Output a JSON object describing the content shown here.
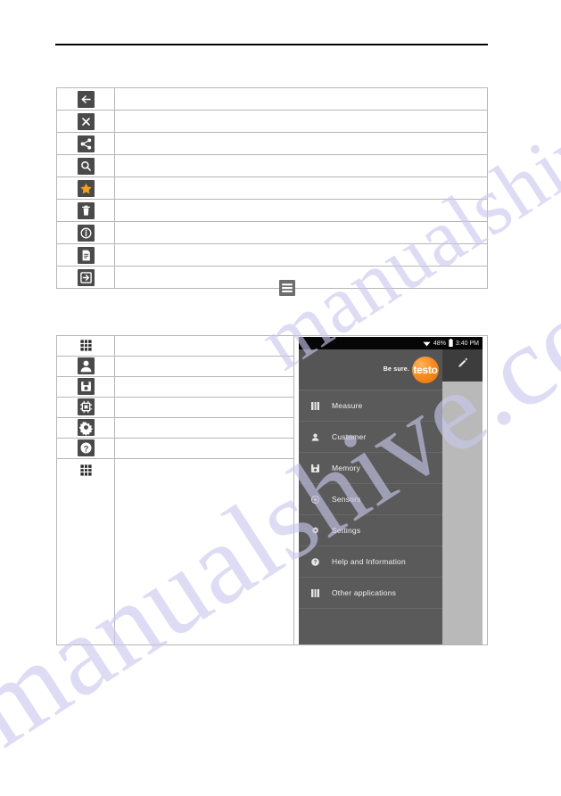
{
  "page": {
    "header_rule": true
  },
  "icon_table_1": {
    "rows": [
      {
        "icon": "back-arrow-icon",
        "description": ""
      },
      {
        "icon": "close-x-icon",
        "description": ""
      },
      {
        "icon": "share-icon",
        "description": ""
      },
      {
        "icon": "search-icon",
        "description": ""
      },
      {
        "icon": "star-favorite-icon",
        "description": ""
      },
      {
        "icon": "trash-delete-icon",
        "description": ""
      },
      {
        "icon": "info-icon",
        "description": ""
      },
      {
        "icon": "document-report-icon",
        "description": ""
      },
      {
        "icon": "exit-logout-icon",
        "description": ""
      }
    ]
  },
  "standalone_icon": {
    "icon": "hamburger-menu-icon"
  },
  "icon_table_2": {
    "rows": [
      {
        "icon": "measure-grid-icon",
        "description": ""
      },
      {
        "icon": "customer-person-icon",
        "description": ""
      },
      {
        "icon": "memory-save-icon",
        "description": ""
      },
      {
        "icon": "sensors-chip-icon",
        "description": ""
      },
      {
        "icon": "settings-gear-icon",
        "description": ""
      },
      {
        "icon": "help-question-icon",
        "description": ""
      },
      {
        "icon": "other-applications-grid-icon",
        "description": ""
      }
    ]
  },
  "phone_screenshot": {
    "statusbar": {
      "wifi_icon": "wifi-icon",
      "battery_percent": "48%",
      "battery_icon": "battery-icon",
      "time": "3:40 PM"
    },
    "action_bar": {
      "edit_icon": "pencil-edit-icon"
    },
    "drawer": {
      "logo": {
        "claim": "Be sure.",
        "brand": "testo",
        "brand_color": "#f58b1f"
      },
      "items": [
        {
          "icon": "measure-grid-icon",
          "label": "Measure"
        },
        {
          "icon": "customer-person-icon",
          "label": "Customer"
        },
        {
          "icon": "memory-save-icon",
          "label": "Memory"
        },
        {
          "icon": "sensors-chip-icon",
          "label": "Sensors"
        },
        {
          "icon": "settings-gear-icon",
          "label": "Settings"
        },
        {
          "icon": "help-question-icon",
          "label": "Help and Information"
        },
        {
          "icon": "other-applications-grid-icon",
          "label": "Other applications"
        }
      ]
    }
  },
  "watermark": {
    "line_1": "manualshive.com",
    "line_2": "manualshive.com"
  },
  "colors": {
    "icon_tile": "#4a4a4a",
    "accent_orange": "#f58b1f",
    "drawer_bg": "#5a5a5a",
    "statusbar_bg": "#060606",
    "table_border": "#b6b6b6"
  }
}
